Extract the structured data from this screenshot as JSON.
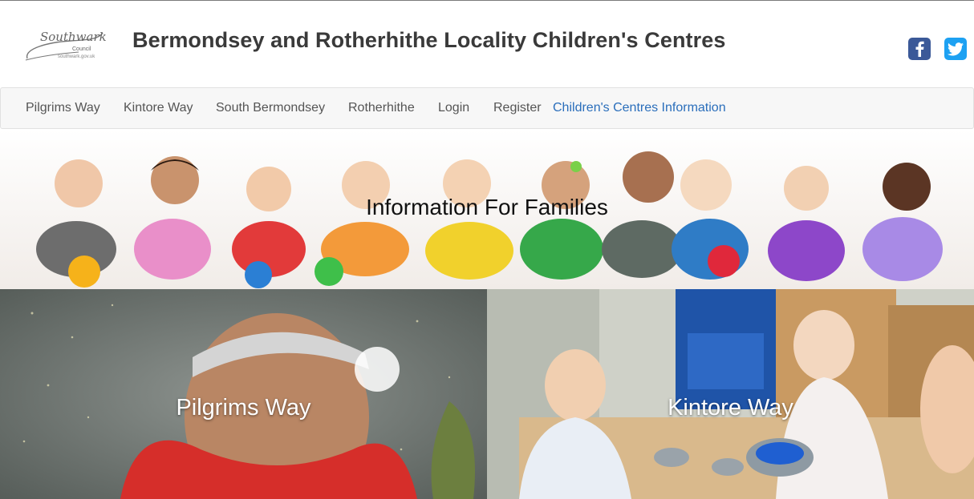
{
  "header": {
    "logo": {
      "text": "Southwark",
      "sub": "Council",
      "url_text": "southwark.gov.uk"
    },
    "title": "Bermondsey and Rotherhithe Locality Children's Centres",
    "social": {
      "facebook_icon": "facebook-icon",
      "twitter_icon": "twitter-icon"
    }
  },
  "nav": {
    "items": [
      {
        "label": "Pilgrims Way"
      },
      {
        "label": "Kintore Way"
      },
      {
        "label": "South Bermondsey"
      },
      {
        "label": "Rotherhithe"
      },
      {
        "label": "Login"
      },
      {
        "label": "Register"
      },
      {
        "label": "Children's Centres Information",
        "active": true
      }
    ]
  },
  "hero": {
    "title": "Information For Families"
  },
  "tiles": [
    {
      "label": "Pilgrims Way"
    },
    {
      "label": "Kintore Way"
    }
  ],
  "colors": {
    "nav_active": "#2a6ebb",
    "facebook": "#3b5998",
    "twitter": "#1da1f2",
    "title_text": "#3a3a3a"
  }
}
